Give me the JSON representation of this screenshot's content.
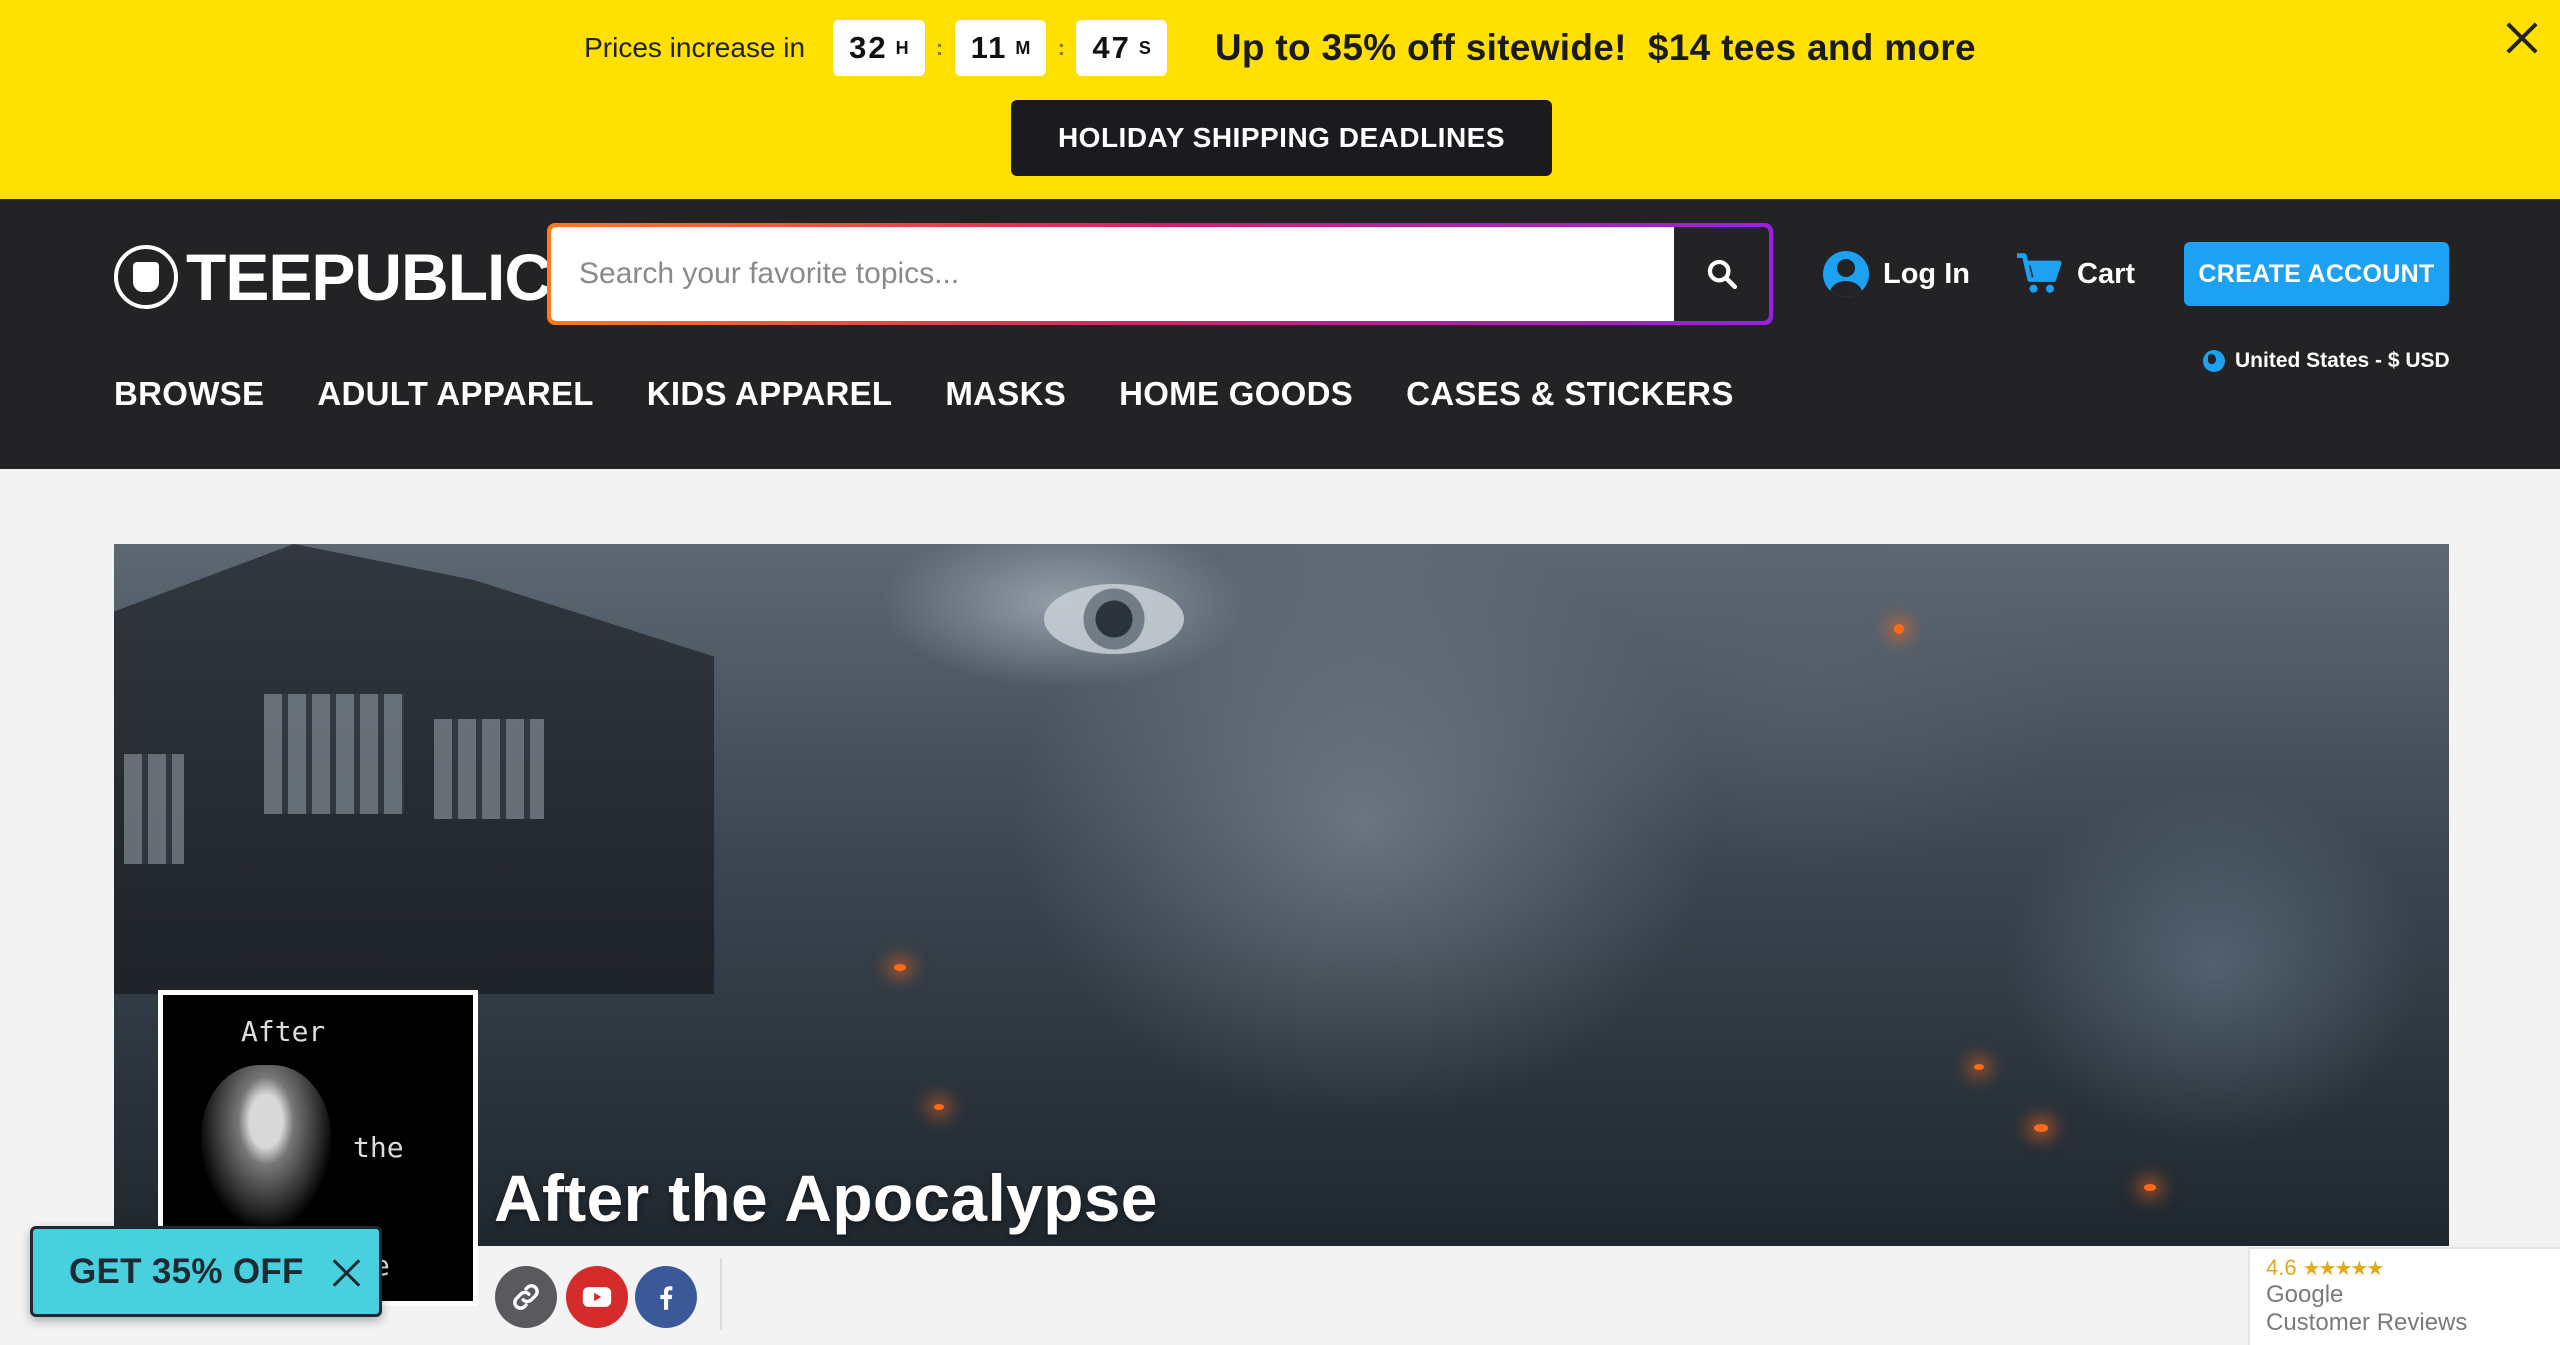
{
  "promo": {
    "prices_label": "Prices increase in",
    "countdown": [
      {
        "value": "32",
        "unit": "H"
      },
      {
        "value": "11",
        "unit": "M"
      },
      {
        "value": "47",
        "unit": "S"
      }
    ],
    "headline": "Up to 35% off sitewide!  $14 tees and more",
    "holiday_button": "HOLIDAY SHIPPING DEADLINES",
    "background_color": "#ffe000"
  },
  "header": {
    "logo_text": "TEEPUBLIC",
    "search_placeholder": "Search your favorite topics...",
    "login_label": "Log In",
    "cart_label": "Cart",
    "create_account_label": "CREATE ACCOUNT",
    "locale_label": "United States - $ USD",
    "accent_color": "#1da1f2"
  },
  "nav": {
    "items": [
      {
        "label": "BROWSE"
      },
      {
        "label": "ADULT APPAREL"
      },
      {
        "label": "KIDS APPAREL"
      },
      {
        "label": "MASKS"
      },
      {
        "label": "HOME GOODS"
      },
      {
        "label": "CASES & STICKERS"
      }
    ]
  },
  "store": {
    "title": "After the Apocalypse",
    "avatar_words": [
      "After",
      "the",
      "e"
    ]
  },
  "share": {
    "icons": [
      "link-icon",
      "youtube-icon",
      "facebook-icon"
    ]
  },
  "discount_widget": {
    "label": "GET 35% OFF"
  },
  "google_reviews": {
    "rating": "4.6",
    "stars": "★★★★★",
    "line1": "Google",
    "line2": "Customer Reviews"
  }
}
